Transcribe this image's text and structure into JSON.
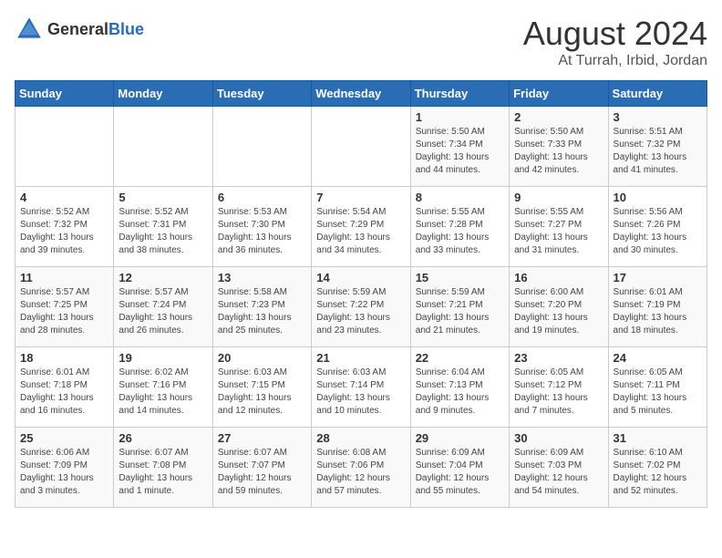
{
  "header": {
    "logo_general": "General",
    "logo_blue": "Blue",
    "month_year": "August 2024",
    "location": "At Turrah, Irbid, Jordan"
  },
  "days_of_week": [
    "Sunday",
    "Monday",
    "Tuesday",
    "Wednesday",
    "Thursday",
    "Friday",
    "Saturday"
  ],
  "weeks": [
    [
      {
        "day": "",
        "info": ""
      },
      {
        "day": "",
        "info": ""
      },
      {
        "day": "",
        "info": ""
      },
      {
        "day": "",
        "info": ""
      },
      {
        "day": "1",
        "info": "Sunrise: 5:50 AM\nSunset: 7:34 PM\nDaylight: 13 hours\nand 44 minutes."
      },
      {
        "day": "2",
        "info": "Sunrise: 5:50 AM\nSunset: 7:33 PM\nDaylight: 13 hours\nand 42 minutes."
      },
      {
        "day": "3",
        "info": "Sunrise: 5:51 AM\nSunset: 7:32 PM\nDaylight: 13 hours\nand 41 minutes."
      }
    ],
    [
      {
        "day": "4",
        "info": "Sunrise: 5:52 AM\nSunset: 7:32 PM\nDaylight: 13 hours\nand 39 minutes."
      },
      {
        "day": "5",
        "info": "Sunrise: 5:52 AM\nSunset: 7:31 PM\nDaylight: 13 hours\nand 38 minutes."
      },
      {
        "day": "6",
        "info": "Sunrise: 5:53 AM\nSunset: 7:30 PM\nDaylight: 13 hours\nand 36 minutes."
      },
      {
        "day": "7",
        "info": "Sunrise: 5:54 AM\nSunset: 7:29 PM\nDaylight: 13 hours\nand 34 minutes."
      },
      {
        "day": "8",
        "info": "Sunrise: 5:55 AM\nSunset: 7:28 PM\nDaylight: 13 hours\nand 33 minutes."
      },
      {
        "day": "9",
        "info": "Sunrise: 5:55 AM\nSunset: 7:27 PM\nDaylight: 13 hours\nand 31 minutes."
      },
      {
        "day": "10",
        "info": "Sunrise: 5:56 AM\nSunset: 7:26 PM\nDaylight: 13 hours\nand 30 minutes."
      }
    ],
    [
      {
        "day": "11",
        "info": "Sunrise: 5:57 AM\nSunset: 7:25 PM\nDaylight: 13 hours\nand 28 minutes."
      },
      {
        "day": "12",
        "info": "Sunrise: 5:57 AM\nSunset: 7:24 PM\nDaylight: 13 hours\nand 26 minutes."
      },
      {
        "day": "13",
        "info": "Sunrise: 5:58 AM\nSunset: 7:23 PM\nDaylight: 13 hours\nand 25 minutes."
      },
      {
        "day": "14",
        "info": "Sunrise: 5:59 AM\nSunset: 7:22 PM\nDaylight: 13 hours\nand 23 minutes."
      },
      {
        "day": "15",
        "info": "Sunrise: 5:59 AM\nSunset: 7:21 PM\nDaylight: 13 hours\nand 21 minutes."
      },
      {
        "day": "16",
        "info": "Sunrise: 6:00 AM\nSunset: 7:20 PM\nDaylight: 13 hours\nand 19 minutes."
      },
      {
        "day": "17",
        "info": "Sunrise: 6:01 AM\nSunset: 7:19 PM\nDaylight: 13 hours\nand 18 minutes."
      }
    ],
    [
      {
        "day": "18",
        "info": "Sunrise: 6:01 AM\nSunset: 7:18 PM\nDaylight: 13 hours\nand 16 minutes."
      },
      {
        "day": "19",
        "info": "Sunrise: 6:02 AM\nSunset: 7:16 PM\nDaylight: 13 hours\nand 14 minutes."
      },
      {
        "day": "20",
        "info": "Sunrise: 6:03 AM\nSunset: 7:15 PM\nDaylight: 13 hours\nand 12 minutes."
      },
      {
        "day": "21",
        "info": "Sunrise: 6:03 AM\nSunset: 7:14 PM\nDaylight: 13 hours\nand 10 minutes."
      },
      {
        "day": "22",
        "info": "Sunrise: 6:04 AM\nSunset: 7:13 PM\nDaylight: 13 hours\nand 9 minutes."
      },
      {
        "day": "23",
        "info": "Sunrise: 6:05 AM\nSunset: 7:12 PM\nDaylight: 13 hours\nand 7 minutes."
      },
      {
        "day": "24",
        "info": "Sunrise: 6:05 AM\nSunset: 7:11 PM\nDaylight: 13 hours\nand 5 minutes."
      }
    ],
    [
      {
        "day": "25",
        "info": "Sunrise: 6:06 AM\nSunset: 7:09 PM\nDaylight: 13 hours\nand 3 minutes."
      },
      {
        "day": "26",
        "info": "Sunrise: 6:07 AM\nSunset: 7:08 PM\nDaylight: 13 hours\nand 1 minute."
      },
      {
        "day": "27",
        "info": "Sunrise: 6:07 AM\nSunset: 7:07 PM\nDaylight: 12 hours\nand 59 minutes."
      },
      {
        "day": "28",
        "info": "Sunrise: 6:08 AM\nSunset: 7:06 PM\nDaylight: 12 hours\nand 57 minutes."
      },
      {
        "day": "29",
        "info": "Sunrise: 6:09 AM\nSunset: 7:04 PM\nDaylight: 12 hours\nand 55 minutes."
      },
      {
        "day": "30",
        "info": "Sunrise: 6:09 AM\nSunset: 7:03 PM\nDaylight: 12 hours\nand 54 minutes."
      },
      {
        "day": "31",
        "info": "Sunrise: 6:10 AM\nSunset: 7:02 PM\nDaylight: 12 hours\nand 52 minutes."
      }
    ]
  ]
}
